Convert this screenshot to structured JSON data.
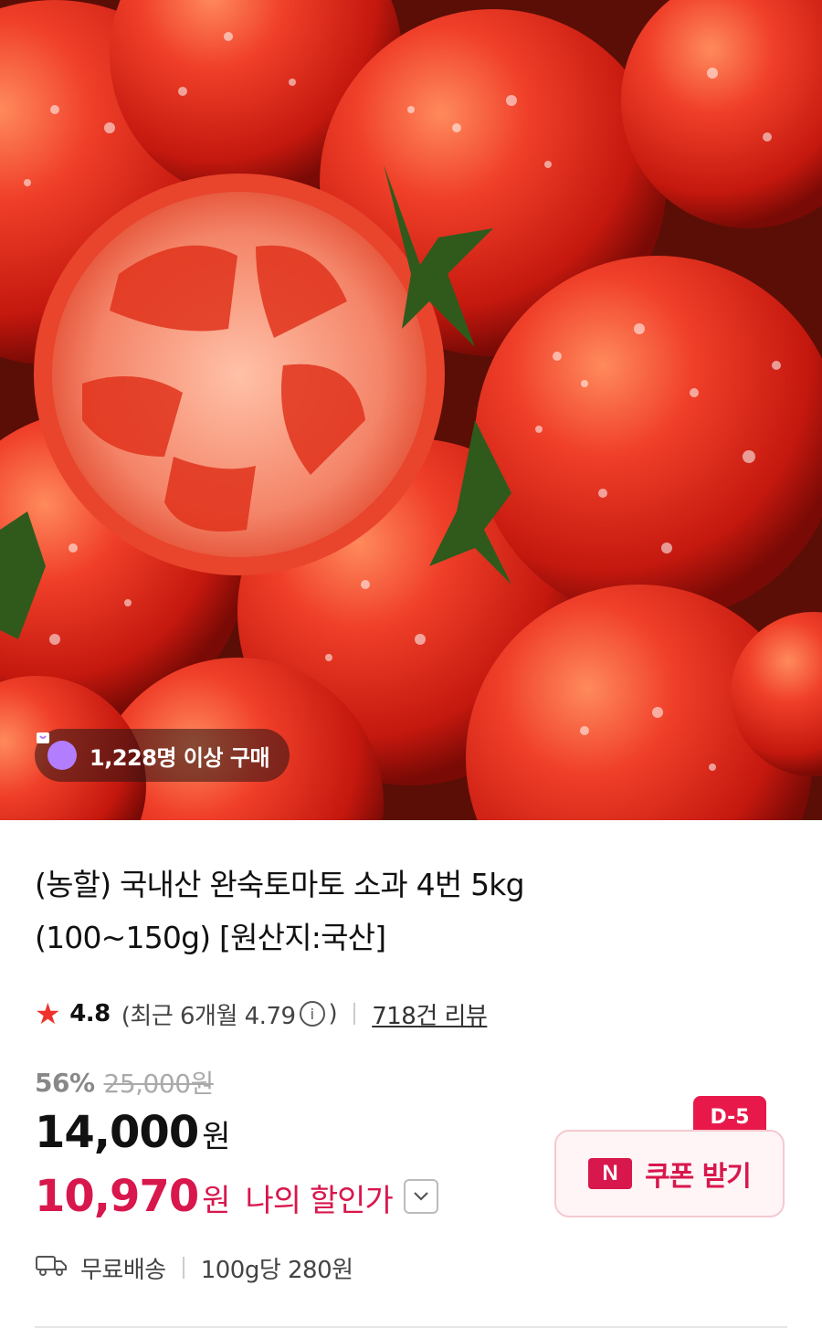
{
  "product": {
    "title_line1": "(농할) 국내산 완숙토마토 소과 4번 5kg",
    "title_line2": "(100~150g) [원산지:국산]",
    "buyers_badge": "1,228명 이상 구매",
    "rating": "4.8",
    "recent_rating_prefix": "(최근 6개월 4.79",
    "recent_rating_suffix": ")",
    "review_count": "718건 리뷰",
    "discount_rate": "56%",
    "original_price": "25,000원",
    "price": "14,000",
    "price_unit": "원",
    "my_price": "10,970",
    "my_price_unit": "원",
    "my_price_label": "나의 할인가",
    "shipping": "무료배송",
    "unit_price": "100g당 280원"
  },
  "coupon": {
    "label": "쿠폰 받기",
    "logo": "N",
    "dday": "D-5"
  },
  "icons": {
    "star": "star-icon",
    "info": "info-icon",
    "chevron": "chevron-down-icon",
    "truck": "truck-icon",
    "bag": "shopping-bag-icon"
  },
  "colors": {
    "accent": "#d8174c",
    "star": "#f0302b",
    "badge_purple": "#b37dff"
  }
}
